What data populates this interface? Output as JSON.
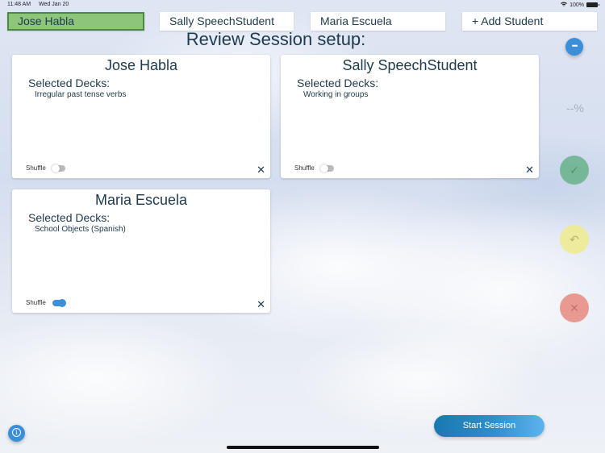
{
  "status_bar": {
    "time": "11:48 AM",
    "date": "Wed Jan 20",
    "battery": "100%",
    "wifi_icon": "wifi-icon",
    "battery_icon": "battery-icon"
  },
  "tabs": [
    {
      "label": "Jose Habla",
      "active": true
    },
    {
      "label": "Sally SpeechStudent",
      "active": false
    },
    {
      "label": "Maria Escuela",
      "active": false
    },
    {
      "label": "+ Add Student",
      "active": false
    }
  ],
  "page_title": "Review Session setup:",
  "students": [
    {
      "name": "Jose Habla",
      "decks_label": "Selected Decks:",
      "decks": [
        "Irregular past tense verbs"
      ],
      "shuffle_label": "Shuffle",
      "shuffle": false,
      "close": "✕"
    },
    {
      "name": "Sally SpeechStudent",
      "decks_label": "Selected Decks:",
      "decks": [
        "Working in groups"
      ],
      "shuffle_label": "Shuffle",
      "shuffle": false,
      "close": "✕"
    },
    {
      "name": "Maria Escuela",
      "decks_label": "Selected Decks:",
      "decks": [
        "School Objects (Spanish)"
      ],
      "shuffle_label": "Shuffle",
      "shuffle": true,
      "close": "✕"
    }
  ],
  "rail": {
    "more_glyph": "•••",
    "percent": "--%",
    "correct_glyph": "✓",
    "undo_glyph": "↶",
    "wrong_glyph": "✕"
  },
  "bottom": {
    "info_glyph": "i",
    "start_label": "Start Session"
  },
  "colors": {
    "active_tab": "#8dc57b",
    "accent_blue": "#3a8fd8",
    "correct": "#5faf82",
    "undo": "#eeeb8c",
    "wrong": "#e68278"
  }
}
